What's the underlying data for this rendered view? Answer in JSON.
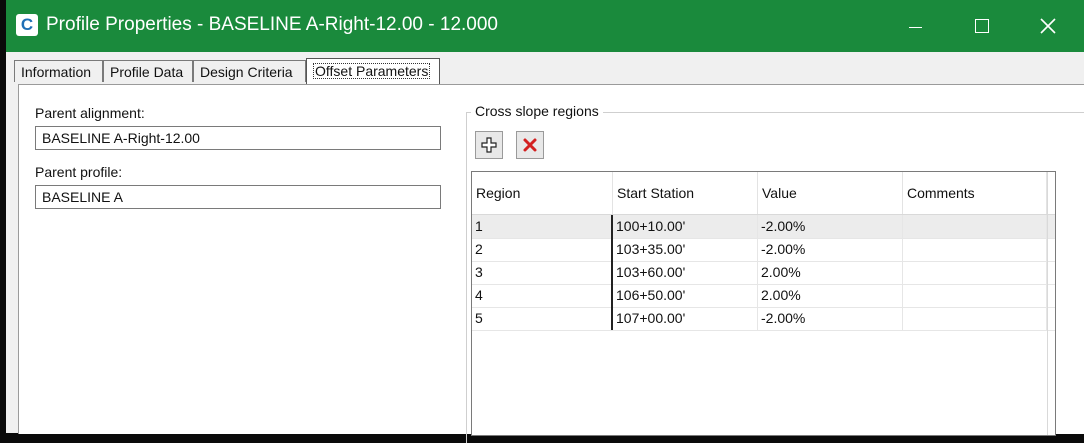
{
  "window": {
    "title": "Profile Properties - BASELINE A-Right-12.00 - 12.000",
    "app_icon_letter": "C",
    "accent_color": "#1a8a3c"
  },
  "tabs": [
    {
      "label": "Information",
      "active": false
    },
    {
      "label": "Profile Data",
      "active": false
    },
    {
      "label": "Design Criteria",
      "active": false
    },
    {
      "label": "Offset Parameters",
      "active": true
    }
  ],
  "form": {
    "parent_alignment_label": "Parent alignment:",
    "parent_alignment_value": "BASELINE A-Right-12.00",
    "parent_profile_label": "Parent profile:",
    "parent_profile_value": "BASELINE A"
  },
  "cross_slope": {
    "group_label": "Cross slope regions",
    "add_icon": "add-region-icon",
    "delete_icon": "delete-region-icon",
    "columns": [
      "Region",
      "Start Station",
      "Value",
      "Comments"
    ],
    "rows": [
      {
        "region": "1",
        "start_station": "100+10.00'",
        "value": "-2.00%",
        "comments": ""
      },
      {
        "region": "2",
        "start_station": "103+35.00'",
        "value": "-2.00%",
        "comments": ""
      },
      {
        "region": "3",
        "start_station": "103+60.00'",
        "value": "2.00%",
        "comments": ""
      },
      {
        "region": "4",
        "start_station": "106+50.00'",
        "value": "2.00%",
        "comments": ""
      },
      {
        "region": "5",
        "start_station": "107+00.00'",
        "value": "-2.00%",
        "comments": ""
      }
    ]
  }
}
